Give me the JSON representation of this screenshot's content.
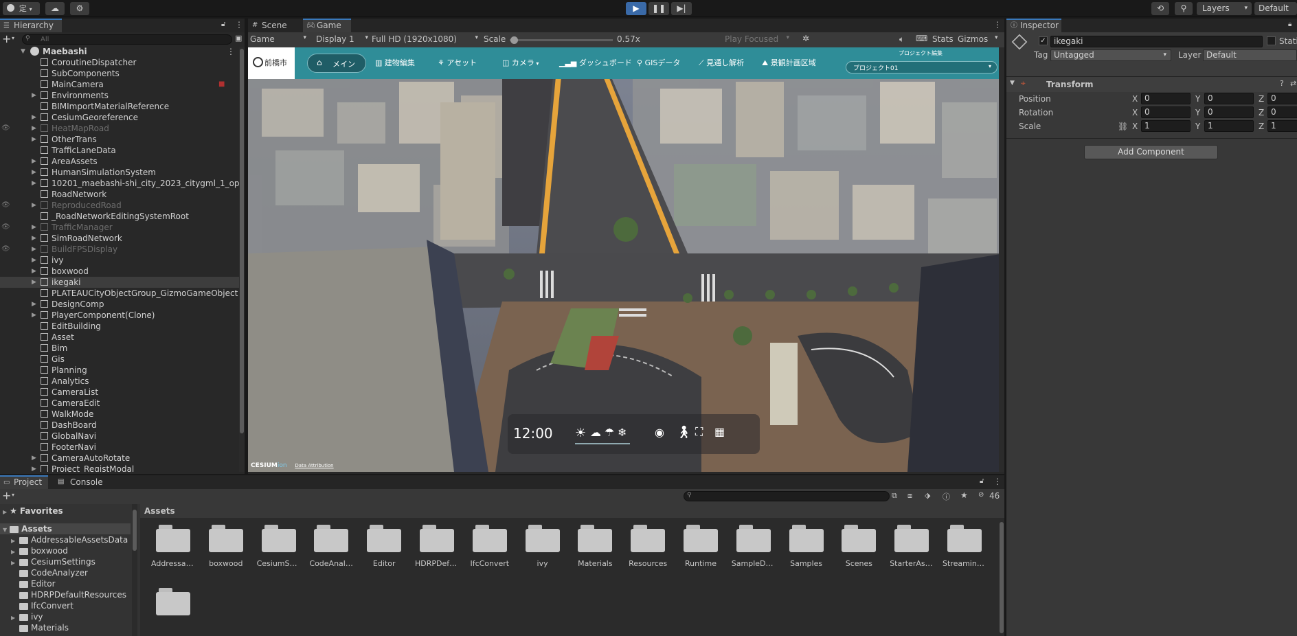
{
  "toolbar": {
    "account_label": "定",
    "layers_label": "Layers",
    "layout_label": "Default"
  },
  "hierarchy": {
    "title": "Hierarchy",
    "search_placeholder": "All",
    "scene": "Maebashi",
    "items": [
      {
        "label": "CoroutineDispatcher",
        "arrow": false,
        "dim": false
      },
      {
        "label": "SubComponents",
        "arrow": false,
        "dim": false
      },
      {
        "label": "MainCamera",
        "arrow": false,
        "dim": false
      },
      {
        "label": "Environments",
        "arrow": true,
        "dim": false
      },
      {
        "label": "BIMImportMaterialReference",
        "arrow": false,
        "dim": false
      },
      {
        "label": "CesiumGeoreference",
        "arrow": true,
        "dim": false
      },
      {
        "label": "HeatMapRoad",
        "arrow": true,
        "dim": true
      },
      {
        "label": "OtherTrans",
        "arrow": true,
        "dim": false
      },
      {
        "label": "TrafficLaneData",
        "arrow": false,
        "dim": false
      },
      {
        "label": "AreaAssets",
        "arrow": true,
        "dim": false
      },
      {
        "label": "HumanSimulationSystem",
        "arrow": true,
        "dim": false
      },
      {
        "label": "10201_maebashi-shi_city_2023_citygml_1_op",
        "arrow": true,
        "dim": false
      },
      {
        "label": "RoadNetwork",
        "arrow": false,
        "dim": false
      },
      {
        "label": "ReproducedRoad",
        "arrow": true,
        "dim": true
      },
      {
        "label": "_RoadNetworkEditingSystemRoot",
        "arrow": false,
        "dim": false
      },
      {
        "label": "TrafficManager",
        "arrow": true,
        "dim": true
      },
      {
        "label": "SimRoadNetwork",
        "arrow": true,
        "dim": false
      },
      {
        "label": "BuildFPSDisplay",
        "arrow": true,
        "dim": true
      },
      {
        "label": "ivy",
        "arrow": true,
        "dim": false
      },
      {
        "label": "boxwood",
        "arrow": true,
        "dim": false
      },
      {
        "label": "ikegaki",
        "arrow": true,
        "dim": false,
        "selected": true
      },
      {
        "label": "PLATEAUCityObjectGroup_GizmoGameObject",
        "arrow": false,
        "dim": false
      },
      {
        "label": "DesignComp",
        "arrow": true,
        "dim": false
      },
      {
        "label": "PlayerComponent(Clone)",
        "arrow": true,
        "dim": false
      },
      {
        "label": "EditBuilding",
        "arrow": false,
        "dim": false
      },
      {
        "label": "Asset",
        "arrow": false,
        "dim": false
      },
      {
        "label": "Bim",
        "arrow": false,
        "dim": false
      },
      {
        "label": "Gis",
        "arrow": false,
        "dim": false
      },
      {
        "label": "Planning",
        "arrow": false,
        "dim": false
      },
      {
        "label": "Analytics",
        "arrow": false,
        "dim": false
      },
      {
        "label": "CameraList",
        "arrow": false,
        "dim": false
      },
      {
        "label": "CameraEdit",
        "arrow": false,
        "dim": false
      },
      {
        "label": "WalkMode",
        "arrow": false,
        "dim": false
      },
      {
        "label": "DashBoard",
        "arrow": false,
        "dim": false
      },
      {
        "label": "GlobalNavi",
        "arrow": false,
        "dim": false
      },
      {
        "label": "FooterNavi",
        "arrow": false,
        "dim": false
      },
      {
        "label": "CameraAutoRotate",
        "arrow": true,
        "dim": false
      },
      {
        "label": "Project_RegistModal",
        "arrow": true,
        "dim": false
      }
    ]
  },
  "view": {
    "tab_scene": "Scene",
    "tab_game": "Game",
    "game_mode": "Game",
    "display": "Display 1",
    "resolution": "Full HD (1920x1080)",
    "scale_label": "Scale",
    "scale_value": "0.57x",
    "play_focused": "Play Focused",
    "stats": "Stats",
    "gizmos": "Gizmos",
    "scale_slider": 0.02
  },
  "game": {
    "logo_text": "前橋市",
    "nav": [
      "メイン",
      "建物編集",
      "アセット",
      "カメラ",
      "ダッシュボード",
      "GISデータ",
      "見通し解析",
      "景観計画区域"
    ],
    "project_label": "プロジェクト編集",
    "project_value": "プロジェクト01",
    "time": "12:00",
    "cesium_text": "CESIUM",
    "cesium_ion": "ion",
    "attribution": "Data Attribution"
  },
  "inspector": {
    "title": "Inspector",
    "object_name": "ikegaki",
    "static_label": "Static",
    "tag_label": "Tag",
    "tag_value": "Untagged",
    "layer_label": "Layer",
    "layer_value": "Default",
    "component": "Transform",
    "position_label": "Position",
    "rotation_label": "Rotation",
    "scale_label": "Scale",
    "position": [
      "0",
      "0",
      "0"
    ],
    "rotation": [
      "0",
      "0",
      "0"
    ],
    "scale": [
      "1",
      "1",
      "1"
    ],
    "add_component": "Add Component",
    "axes": [
      "X",
      "Y",
      "Z"
    ]
  },
  "project": {
    "tab_project": "Project",
    "tab_console": "Console",
    "favorites": "Favorites",
    "assets": "Assets",
    "breadcrumb": "Assets",
    "hidden_count": "46",
    "tree": [
      {
        "label": "AddressableAssetsData",
        "arrow": true
      },
      {
        "label": "boxwood",
        "arrow": true
      },
      {
        "label": "CesiumSettings",
        "arrow": true
      },
      {
        "label": "CodeAnalyzer",
        "arrow": false
      },
      {
        "label": "Editor",
        "arrow": false
      },
      {
        "label": "HDRPDefaultResources",
        "arrow": false
      },
      {
        "label": "IfcConvert",
        "arrow": false
      },
      {
        "label": "ivy",
        "arrow": true
      },
      {
        "label": "Materials",
        "arrow": false
      }
    ],
    "folders": [
      "Addressab...",
      "boxwood",
      "CesiumSett...",
      "CodeAnaly...",
      "Editor",
      "HDRPDefau...",
      "IfcConvert",
      "ivy",
      "Materials",
      "Resources",
      "Runtime",
      "SampleDat...",
      "Samples",
      "Scenes",
      "StarterAss...",
      "Streaming..."
    ]
  }
}
